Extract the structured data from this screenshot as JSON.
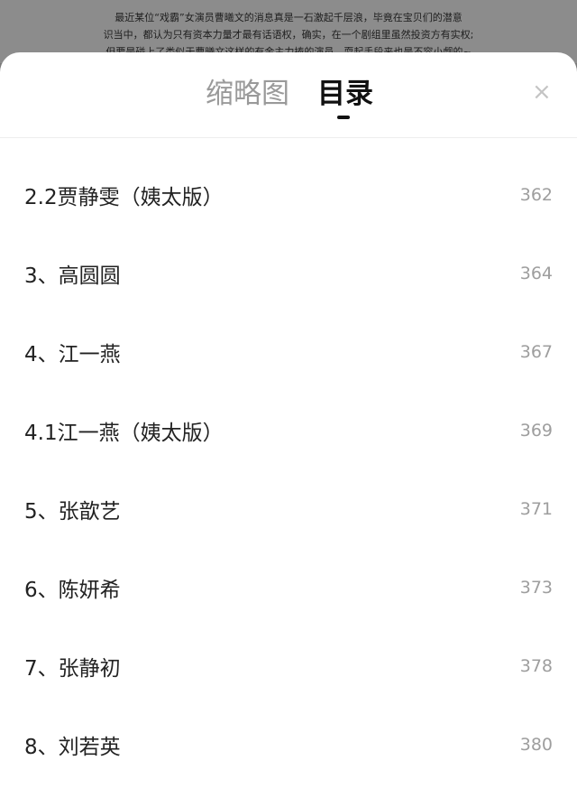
{
  "background": {
    "lines": [
      "最近某位“戏霸”女演员曹曦文的消息真是一石激起千层浪，毕竟在宝贝们的潜意",
      "识当中，都认为只有资本力量才最有话语权，确实，在一个剧组里虽然投资方有实权;",
      "但要是碰上了类似于曹曦文这样的有金主力捧的演员，耍起手段来也是不容小觑的~"
    ]
  },
  "header": {
    "tab_thumbnail": "缩略图",
    "tab_toc": "目录",
    "close_symbol": "×"
  },
  "toc": {
    "items": [
      {
        "title": "2.2贾静雯（姨太版）",
        "page": "362"
      },
      {
        "title": "3、高圆圆",
        "page": "364"
      },
      {
        "title": "4、江一燕",
        "page": "367"
      },
      {
        "title": "4.1江一燕（姨太版）",
        "page": "369"
      },
      {
        "title": "5、张歆艺",
        "page": "371"
      },
      {
        "title": "6、陈妍希",
        "page": "373"
      },
      {
        "title": "7、张静初",
        "page": "378"
      },
      {
        "title": "8、刘若英",
        "page": "380"
      }
    ]
  },
  "colors": {
    "active_tab": "#111111",
    "inactive_tab": "#9a9a9a",
    "page_number": "#9e9e9e"
  }
}
